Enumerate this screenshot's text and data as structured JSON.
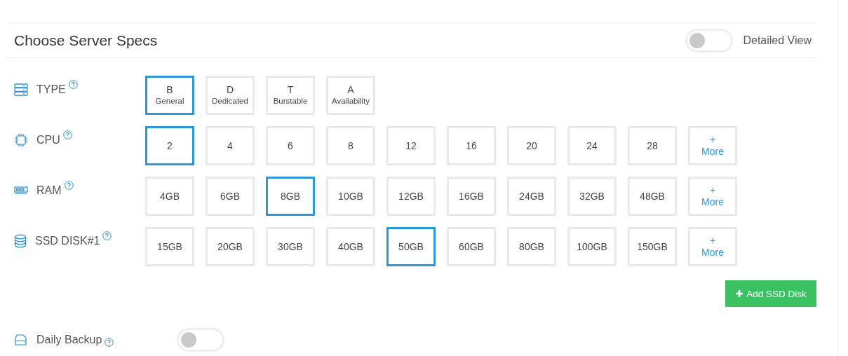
{
  "header": {
    "title": "Choose Server Specs",
    "toggle": {
      "label": "Detailed View",
      "on": false
    }
  },
  "specs": [
    {
      "kind": "server",
      "label": "TYPE",
      "options": [
        {
          "kind": "type",
          "letter": "B",
          "label": "General",
          "selected": true
        },
        {
          "kind": "type",
          "letter": "D",
          "label": "Dedicated",
          "selected": false
        },
        {
          "kind": "type",
          "letter": "T",
          "label": "Burstable",
          "selected": false
        },
        {
          "kind": "type",
          "letter": "A",
          "label": "Availability",
          "selected": false
        }
      ]
    },
    {
      "kind": "chip",
      "label": "CPU",
      "options": [
        {
          "kind": "value",
          "label": "2",
          "selected": true
        },
        {
          "kind": "value",
          "label": "4",
          "selected": false
        },
        {
          "kind": "value",
          "label": "6",
          "selected": false
        },
        {
          "kind": "value",
          "label": "8",
          "selected": false
        },
        {
          "kind": "value",
          "label": "12",
          "selected": false
        },
        {
          "kind": "value",
          "label": "16",
          "selected": false
        },
        {
          "kind": "value",
          "label": "20",
          "selected": false
        },
        {
          "kind": "value",
          "label": "24",
          "selected": false
        },
        {
          "kind": "value",
          "label": "28",
          "selected": false
        },
        {
          "kind": "more",
          "letter": "+",
          "label": "More",
          "selected": false
        }
      ]
    },
    {
      "kind": "ram",
      "label": "RAM",
      "options": [
        {
          "kind": "value",
          "label": "4GB",
          "selected": false
        },
        {
          "kind": "value",
          "label": "6GB",
          "selected": false
        },
        {
          "kind": "value",
          "label": "8GB",
          "selected": true
        },
        {
          "kind": "value",
          "label": "10GB",
          "selected": false
        },
        {
          "kind": "value",
          "label": "12GB",
          "selected": false
        },
        {
          "kind": "value",
          "label": "16GB",
          "selected": false
        },
        {
          "kind": "value",
          "label": "24GB",
          "selected": false
        },
        {
          "kind": "value",
          "label": "32GB",
          "selected": false
        },
        {
          "kind": "value",
          "label": "48GB",
          "selected": false
        },
        {
          "kind": "more",
          "letter": "+",
          "label": "More",
          "selected": false
        }
      ]
    },
    {
      "kind": "database",
      "label": "SSD DISK#1",
      "options": [
        {
          "kind": "value",
          "label": "15GB",
          "selected": false
        },
        {
          "kind": "value",
          "label": "20GB",
          "selected": false
        },
        {
          "kind": "value",
          "label": "30GB",
          "selected": false
        },
        {
          "kind": "value",
          "label": "40GB",
          "selected": false
        },
        {
          "kind": "value",
          "label": "50GB",
          "selected": true
        },
        {
          "kind": "value",
          "label": "60GB",
          "selected": false
        },
        {
          "kind": "value",
          "label": "80GB",
          "selected": false
        },
        {
          "kind": "value",
          "label": "100GB",
          "selected": false
        },
        {
          "kind": "value",
          "label": "150GB",
          "selected": false
        },
        {
          "kind": "more",
          "letter": "+",
          "label": "More",
          "selected": false
        }
      ]
    }
  ],
  "add_button": "Add SSD Disk",
  "backup": {
    "label": "Daily Backup",
    "on": false
  }
}
